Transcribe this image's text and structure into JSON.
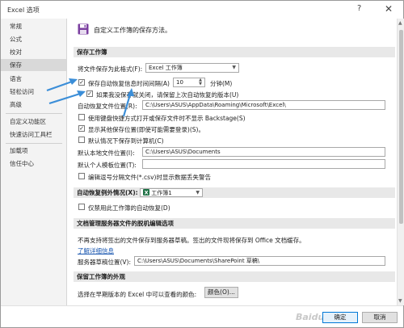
{
  "window": {
    "title": "Excel 选项",
    "help_icon": "?",
    "close_icon": "✕"
  },
  "sidebar": {
    "items": [
      {
        "label": "常规"
      },
      {
        "label": "公式"
      },
      {
        "label": "校对"
      },
      {
        "label": "保存",
        "active": true
      },
      {
        "label": "语言"
      },
      {
        "label": "轻松访问"
      },
      {
        "label": "高级"
      },
      {
        "label": "自定义功能区"
      },
      {
        "label": "快速访问工具栏"
      },
      {
        "label": "加载项"
      },
      {
        "label": "信任中心"
      }
    ]
  },
  "header": {
    "icon": "save-icon",
    "description": "自定义工作簿的保存方法。"
  },
  "save_workbooks": {
    "title": "保存工作簿",
    "format_label": "将文件保存为此格式(F):",
    "format_value": "Excel 工作簿",
    "autorecover_label": "保存自动恢复信息时间间隔(A)",
    "autorecover_minutes": "10",
    "minutes_label": "分钟(M)",
    "keep_last_label": "如果我没保存就关闭，请保留上次自动恢复的版本(U)",
    "autorecover_location_label": "自动恢复文件位置(R):",
    "autorecover_location_value": "C:\\Users\\ASUS\\AppData\\Roaming\\Microsoft\\Excel\\",
    "no_backstage_label": "使用键盘快捷方式打开或保存文件时不显示 Backstage(S)",
    "show_additional_label": "显示其他保存位置(即使可能需要登录)(S)。",
    "default_computer_label": "默认情况下保存到计算机(C)",
    "default_local_label": "默认本地文件位置(I):",
    "default_local_value": "C:\\Users\\ASUS\\Documents",
    "personal_templates_label": "默认个人模板位置(T):",
    "personal_templates_value": "",
    "csv_warning_label": "编辑逗号分隔文件(*.csv)时显示数据丢失警告"
  },
  "autorecover_exceptions": {
    "title": "自动恢复例外情况(X):",
    "workbook_value": "工作簿1",
    "disable_label": "仅禁用此工作簿的自动恢复(D)"
  },
  "offline_editing": {
    "title": "文档管理服务器文件的脱机编辑选项",
    "info_text": "不再支持将签出的文件保存到服务器草稿。签出的文件现将保存到 Office 文档缓存。",
    "learn_more": "了解详细信息",
    "drafts_label": "服务器草稿位置(V):",
    "drafts_value": "C:\\Users\\ASUS\\Documents\\SharePoint 草稿\\"
  },
  "preserve_visual": {
    "title": "保留工作簿的外观",
    "colors_label": "选择在早期版本的 Excel 中可以查看的颜色:",
    "colors_button": "颜色(O)..."
  },
  "footer": {
    "ok_label": "确定",
    "cancel_label": "取消",
    "watermark": "Baidu经验"
  },
  "colors": {
    "arrow": "#3b8ed8",
    "excel_green": "#1e7145",
    "save_icon": "#7b3fa0"
  }
}
